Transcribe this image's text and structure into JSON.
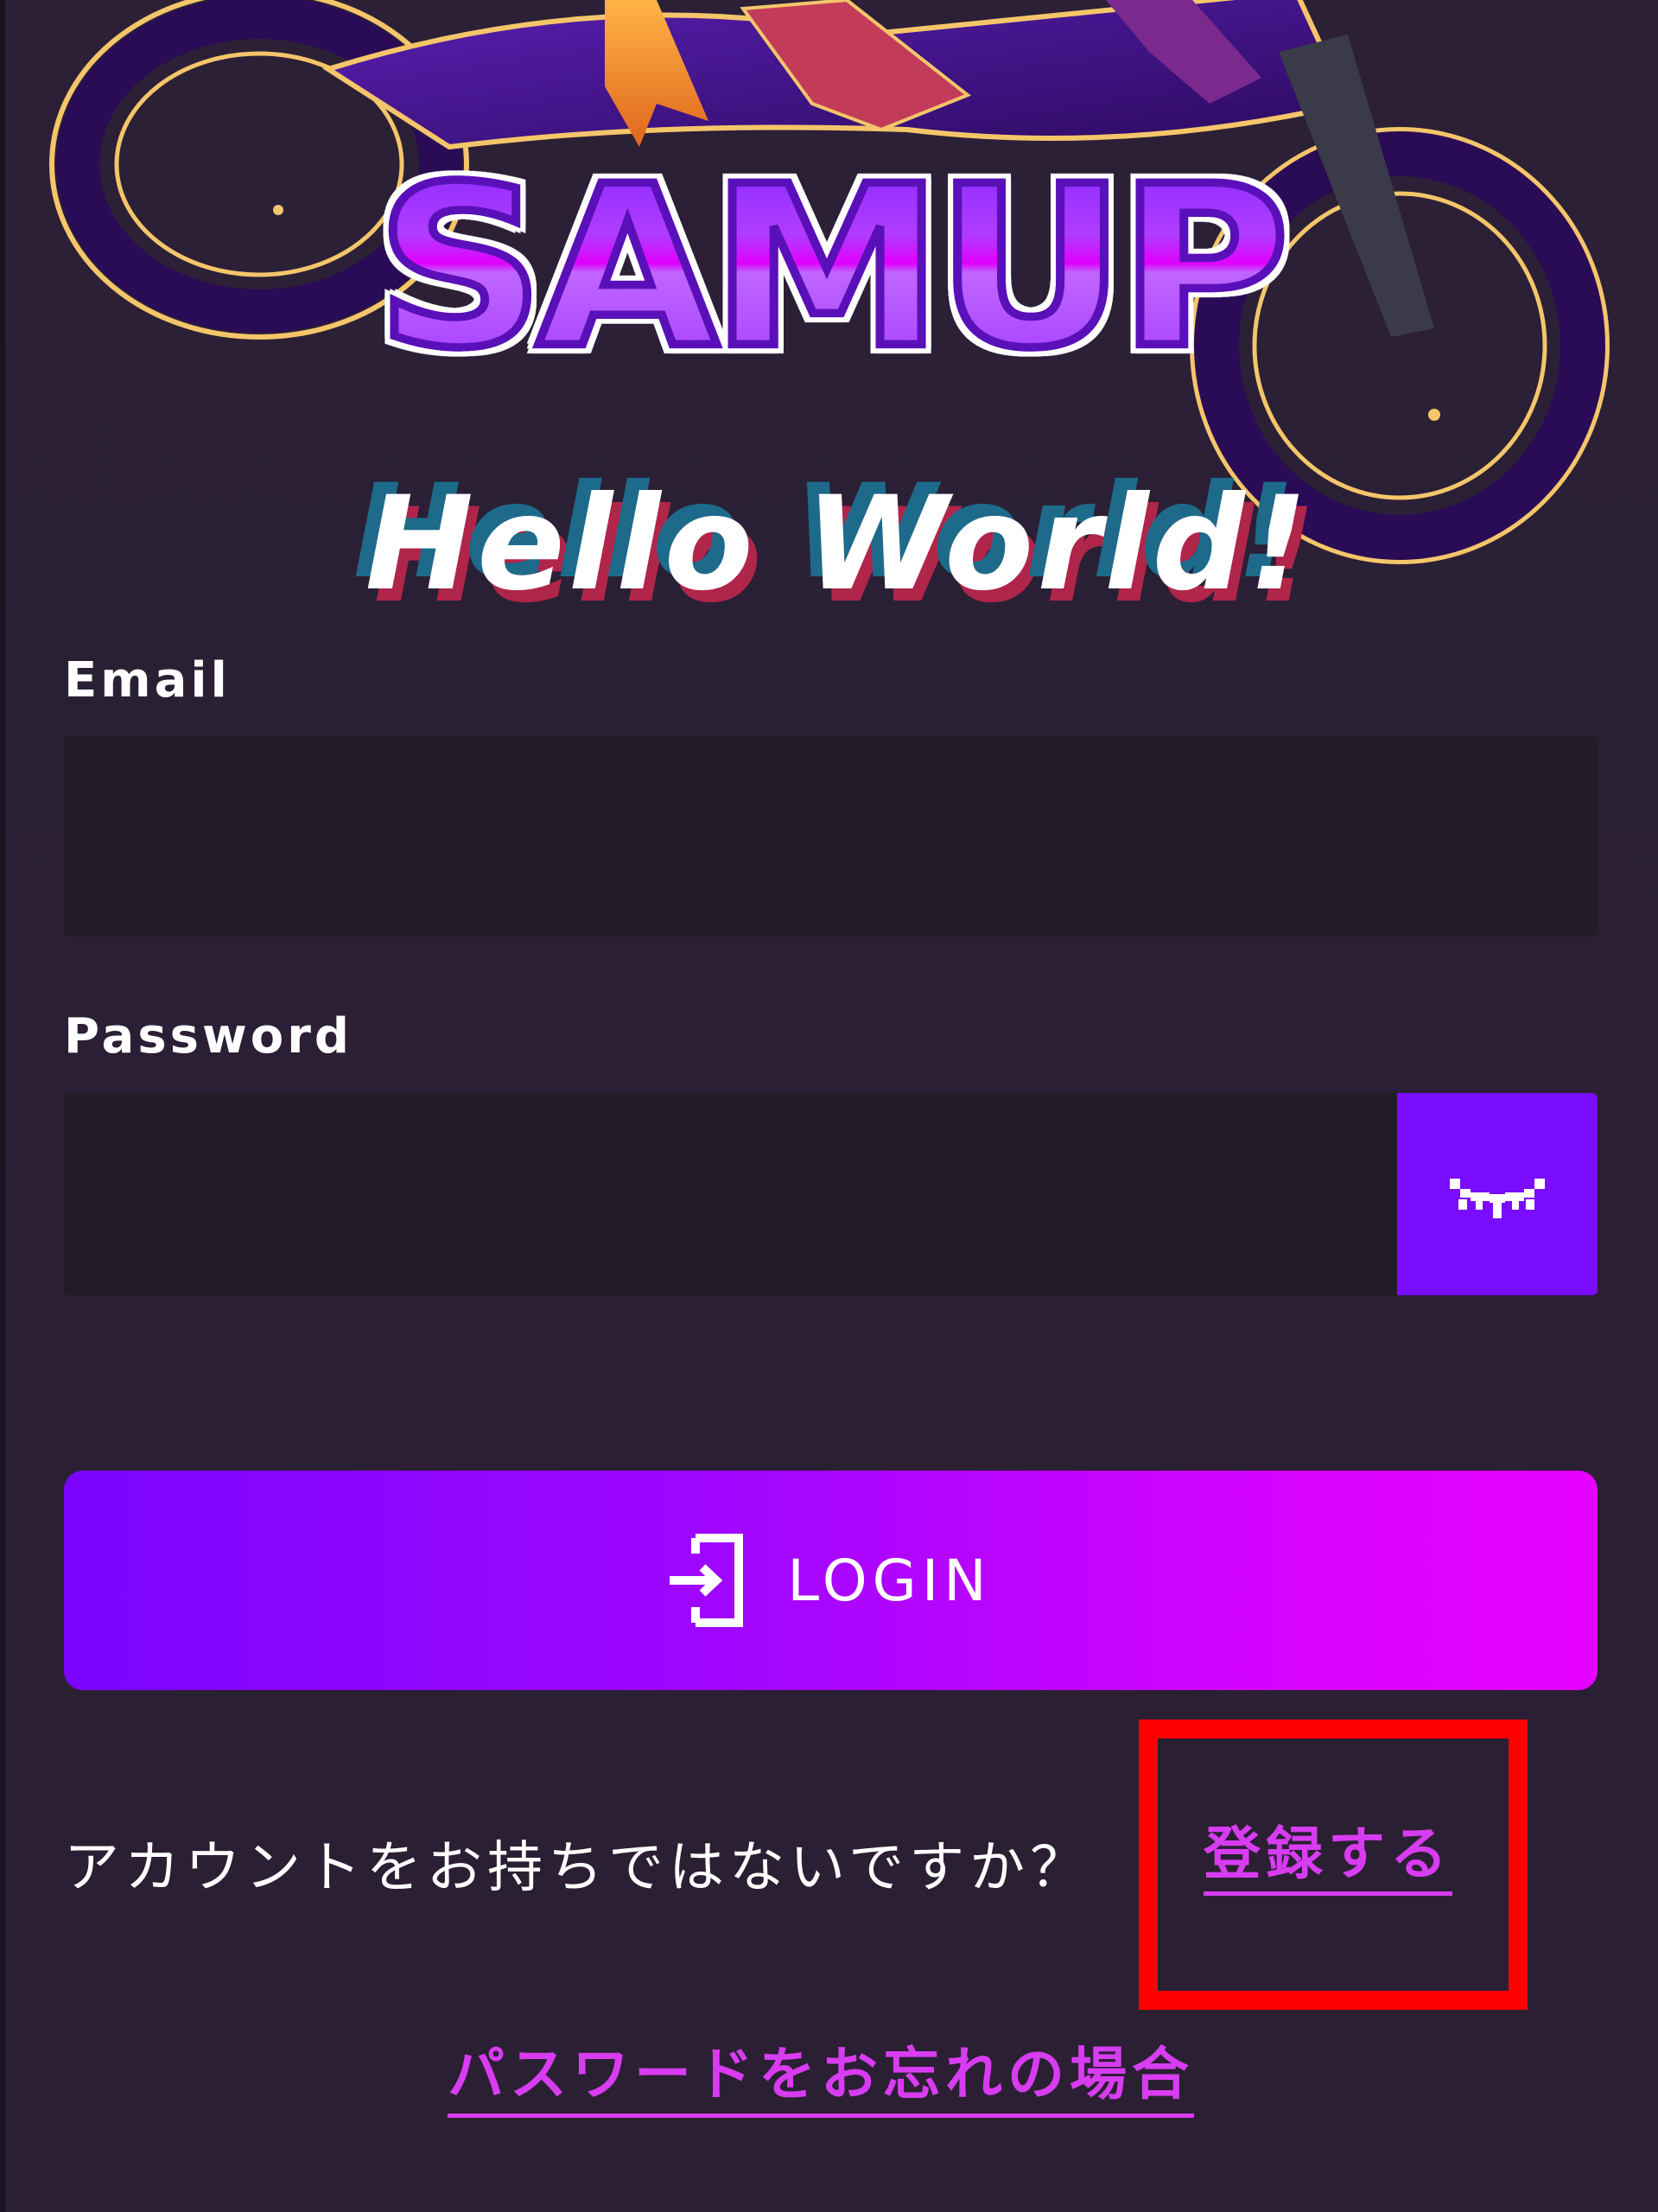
{
  "brand": {
    "logo_text": "SAMUP",
    "tagline": "Hello World!",
    "colors": {
      "background": "#2a1f33",
      "accent_purple": "#7a0cff",
      "accent_magenta": "#e600ff",
      "link": "#d83cf0",
      "input_bg": "#221c28",
      "highlight": "#ff0000"
    }
  },
  "form": {
    "email_label": "Email",
    "email_value": "",
    "password_label": "Password",
    "password_value": "",
    "toggle_icon": "eye-closed-icon",
    "login_icon": "login-enter-icon",
    "login_label": "LOGIN"
  },
  "footer": {
    "no_account_text": "アカウントをお持ちではないですか？",
    "register_link": "登録する",
    "forgot_password_link": "パスワードをお忘れの場合"
  }
}
